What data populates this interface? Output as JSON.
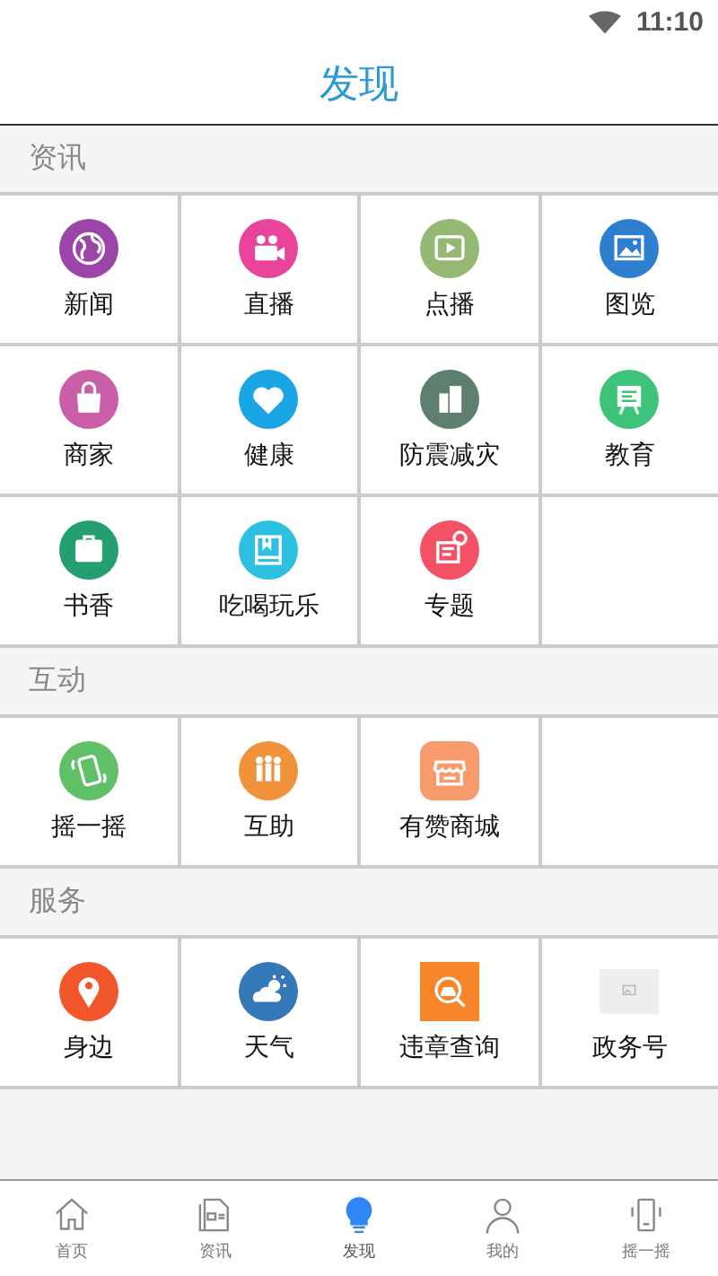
{
  "status_bar": {
    "time": "11:10"
  },
  "title": "发现",
  "sections": [
    {
      "title": "资讯",
      "items": [
        {
          "label": "新闻",
          "kind": "circle",
          "color": "#9b45a8"
        },
        {
          "label": "直播",
          "kind": "circle",
          "color": "#e8459a"
        },
        {
          "label": "点播",
          "kind": "circle",
          "color": "#95b872"
        },
        {
          "label": "图览",
          "kind": "circle",
          "color": "#2f7fd0"
        },
        {
          "label": "商家",
          "kind": "circle",
          "color": "#c95fa8"
        },
        {
          "label": "健康",
          "kind": "circle",
          "color": "#1aa6e6"
        },
        {
          "label": "防震减灾",
          "kind": "circle",
          "color": "#5e7f70"
        },
        {
          "label": "教育",
          "kind": "circle",
          "color": "#3dc47a"
        },
        {
          "label": "书香",
          "kind": "circle",
          "color": "#24a070"
        },
        {
          "label": "吃喝玩乐",
          "kind": "circle",
          "color": "#2ec0e0"
        },
        {
          "label": "专题",
          "kind": "circle",
          "color": "#f25264"
        }
      ]
    },
    {
      "title": "互动",
      "items": [
        {
          "label": "摇一摇",
          "kind": "circle",
          "color": "#5fc068"
        },
        {
          "label": "互助",
          "kind": "circle",
          "color": "#f0923a"
        },
        {
          "label": "有赞商城",
          "kind": "rounded",
          "color": "#f79a6c"
        }
      ]
    },
    {
      "title": "服务",
      "items": [
        {
          "label": "身边",
          "kind": "circle",
          "color": "#f2572c"
        },
        {
          "label": "天气",
          "kind": "circle",
          "color": "#3578b8"
        },
        {
          "label": "违章查询",
          "kind": "square",
          "color": "#f7862a"
        },
        {
          "label": "政务号",
          "kind": "placeholder",
          "color": "#eeeeee"
        }
      ]
    }
  ],
  "nav": [
    {
      "label": "首页",
      "selected": false
    },
    {
      "label": "资讯",
      "selected": false
    },
    {
      "label": "发现",
      "selected": true
    },
    {
      "label": "我的",
      "selected": false
    },
    {
      "label": "摇一摇",
      "selected": false
    }
  ]
}
